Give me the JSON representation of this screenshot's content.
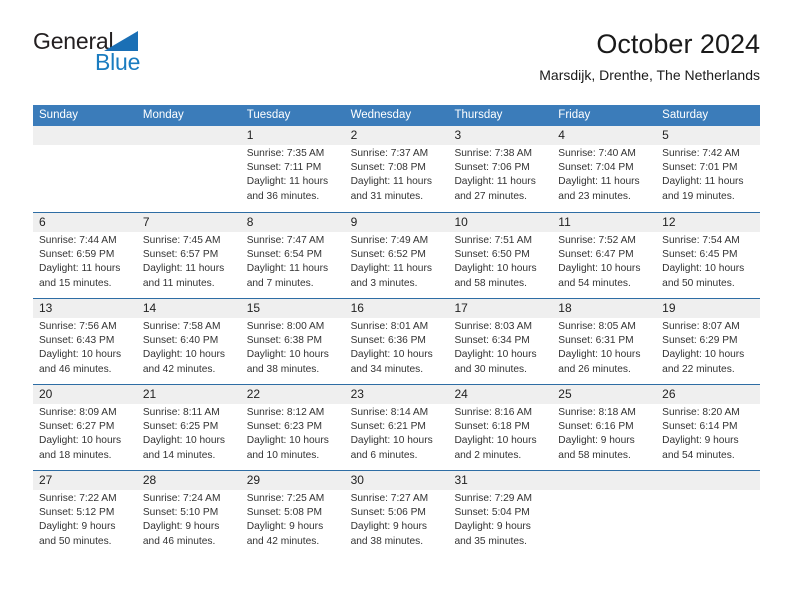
{
  "brand": {
    "name_top": "General",
    "name_bottom": "Blue",
    "triangle_icon": "triangle-icon",
    "color_top": "#231f20",
    "color_bottom": "#1a7cc0",
    "triangle_color": "#1a6fb5"
  },
  "header": {
    "title": "October 2024",
    "subtitle": "Marsdijk, Drenthe, The Netherlands"
  },
  "theme": {
    "header_blue": "#3b7cba",
    "row_divider_blue": "#2e6da4",
    "daynum_strip_gray": "#efefef"
  },
  "calendar": {
    "weekday_headers": [
      "Sunday",
      "Monday",
      "Tuesday",
      "Wednesday",
      "Thursday",
      "Friday",
      "Saturday"
    ],
    "weeks": [
      [
        {
          "day": "",
          "lines": []
        },
        {
          "day": "",
          "lines": []
        },
        {
          "day": "1",
          "lines": [
            "Sunrise: 7:35 AM",
            "Sunset: 7:11 PM",
            "Daylight: 11 hours",
            "and 36 minutes."
          ]
        },
        {
          "day": "2",
          "lines": [
            "Sunrise: 7:37 AM",
            "Sunset: 7:08 PM",
            "Daylight: 11 hours",
            "and 31 minutes."
          ]
        },
        {
          "day": "3",
          "lines": [
            "Sunrise: 7:38 AM",
            "Sunset: 7:06 PM",
            "Daylight: 11 hours",
            "and 27 minutes."
          ]
        },
        {
          "day": "4",
          "lines": [
            "Sunrise: 7:40 AM",
            "Sunset: 7:04 PM",
            "Daylight: 11 hours",
            "and 23 minutes."
          ]
        },
        {
          "day": "5",
          "lines": [
            "Sunrise: 7:42 AM",
            "Sunset: 7:01 PM",
            "Daylight: 11 hours",
            "and 19 minutes."
          ]
        }
      ],
      [
        {
          "day": "6",
          "lines": [
            "Sunrise: 7:44 AM",
            "Sunset: 6:59 PM",
            "Daylight: 11 hours",
            "and 15 minutes."
          ]
        },
        {
          "day": "7",
          "lines": [
            "Sunrise: 7:45 AM",
            "Sunset: 6:57 PM",
            "Daylight: 11 hours",
            "and 11 minutes."
          ]
        },
        {
          "day": "8",
          "lines": [
            "Sunrise: 7:47 AM",
            "Sunset: 6:54 PM",
            "Daylight: 11 hours",
            "and 7 minutes."
          ]
        },
        {
          "day": "9",
          "lines": [
            "Sunrise: 7:49 AM",
            "Sunset: 6:52 PM",
            "Daylight: 11 hours",
            "and 3 minutes."
          ]
        },
        {
          "day": "10",
          "lines": [
            "Sunrise: 7:51 AM",
            "Sunset: 6:50 PM",
            "Daylight: 10 hours",
            "and 58 minutes."
          ]
        },
        {
          "day": "11",
          "lines": [
            "Sunrise: 7:52 AM",
            "Sunset: 6:47 PM",
            "Daylight: 10 hours",
            "and 54 minutes."
          ]
        },
        {
          "day": "12",
          "lines": [
            "Sunrise: 7:54 AM",
            "Sunset: 6:45 PM",
            "Daylight: 10 hours",
            "and 50 minutes."
          ]
        }
      ],
      [
        {
          "day": "13",
          "lines": [
            "Sunrise: 7:56 AM",
            "Sunset: 6:43 PM",
            "Daylight: 10 hours",
            "and 46 minutes."
          ]
        },
        {
          "day": "14",
          "lines": [
            "Sunrise: 7:58 AM",
            "Sunset: 6:40 PM",
            "Daylight: 10 hours",
            "and 42 minutes."
          ]
        },
        {
          "day": "15",
          "lines": [
            "Sunrise: 8:00 AM",
            "Sunset: 6:38 PM",
            "Daylight: 10 hours",
            "and 38 minutes."
          ]
        },
        {
          "day": "16",
          "lines": [
            "Sunrise: 8:01 AM",
            "Sunset: 6:36 PM",
            "Daylight: 10 hours",
            "and 34 minutes."
          ]
        },
        {
          "day": "17",
          "lines": [
            "Sunrise: 8:03 AM",
            "Sunset: 6:34 PM",
            "Daylight: 10 hours",
            "and 30 minutes."
          ]
        },
        {
          "day": "18",
          "lines": [
            "Sunrise: 8:05 AM",
            "Sunset: 6:31 PM",
            "Daylight: 10 hours",
            "and 26 minutes."
          ]
        },
        {
          "day": "19",
          "lines": [
            "Sunrise: 8:07 AM",
            "Sunset: 6:29 PM",
            "Daylight: 10 hours",
            "and 22 minutes."
          ]
        }
      ],
      [
        {
          "day": "20",
          "lines": [
            "Sunrise: 8:09 AM",
            "Sunset: 6:27 PM",
            "Daylight: 10 hours",
            "and 18 minutes."
          ]
        },
        {
          "day": "21",
          "lines": [
            "Sunrise: 8:11 AM",
            "Sunset: 6:25 PM",
            "Daylight: 10 hours",
            "and 14 minutes."
          ]
        },
        {
          "day": "22",
          "lines": [
            "Sunrise: 8:12 AM",
            "Sunset: 6:23 PM",
            "Daylight: 10 hours",
            "and 10 minutes."
          ]
        },
        {
          "day": "23",
          "lines": [
            "Sunrise: 8:14 AM",
            "Sunset: 6:21 PM",
            "Daylight: 10 hours",
            "and 6 minutes."
          ]
        },
        {
          "day": "24",
          "lines": [
            "Sunrise: 8:16 AM",
            "Sunset: 6:18 PM",
            "Daylight: 10 hours",
            "and 2 minutes."
          ]
        },
        {
          "day": "25",
          "lines": [
            "Sunrise: 8:18 AM",
            "Sunset: 6:16 PM",
            "Daylight: 9 hours",
            "and 58 minutes."
          ]
        },
        {
          "day": "26",
          "lines": [
            "Sunrise: 8:20 AM",
            "Sunset: 6:14 PM",
            "Daylight: 9 hours",
            "and 54 minutes."
          ]
        }
      ],
      [
        {
          "day": "27",
          "lines": [
            "Sunrise: 7:22 AM",
            "Sunset: 5:12 PM",
            "Daylight: 9 hours",
            "and 50 minutes."
          ]
        },
        {
          "day": "28",
          "lines": [
            "Sunrise: 7:24 AM",
            "Sunset: 5:10 PM",
            "Daylight: 9 hours",
            "and 46 minutes."
          ]
        },
        {
          "day": "29",
          "lines": [
            "Sunrise: 7:25 AM",
            "Sunset: 5:08 PM",
            "Daylight: 9 hours",
            "and 42 minutes."
          ]
        },
        {
          "day": "30",
          "lines": [
            "Sunrise: 7:27 AM",
            "Sunset: 5:06 PM",
            "Daylight: 9 hours",
            "and 38 minutes."
          ]
        },
        {
          "day": "31",
          "lines": [
            "Sunrise: 7:29 AM",
            "Sunset: 5:04 PM",
            "Daylight: 9 hours",
            "and 35 minutes."
          ]
        },
        {
          "day": "",
          "lines": []
        },
        {
          "day": "",
          "lines": []
        }
      ]
    ]
  }
}
